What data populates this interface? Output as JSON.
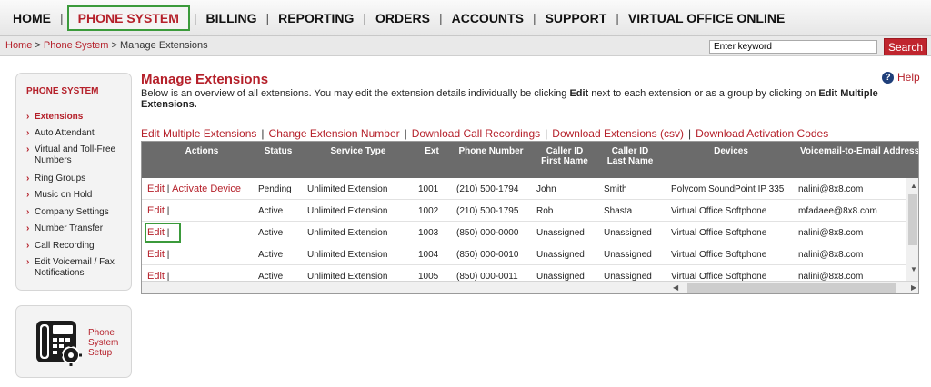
{
  "nav": {
    "items": [
      "HOME",
      "PHONE SYSTEM",
      "BILLING",
      "REPORTING",
      "ORDERS",
      "ACCOUNTS",
      "SUPPORT",
      "VIRTUAL OFFICE ONLINE"
    ],
    "active_index": 1,
    "separator": "|"
  },
  "breadcrumb": {
    "home": "Home",
    "phone_system": "Phone System",
    "current": "Manage Extensions",
    "separator": ">"
  },
  "search": {
    "value": "Enter keyword",
    "button_label": "Search"
  },
  "sidebar": {
    "title": "PHONE SYSTEM",
    "items": [
      {
        "label": "Extensions",
        "active": true
      },
      {
        "label": "Auto Attendant",
        "active": false
      },
      {
        "label": "Virtual and Toll-Free Numbers",
        "active": false
      },
      {
        "label": "Ring Groups",
        "active": false
      },
      {
        "label": "Music on Hold",
        "active": false
      },
      {
        "label": "Company Settings",
        "active": false
      },
      {
        "label": "Number Transfer",
        "active": false
      },
      {
        "label": "Call Recording",
        "active": false
      },
      {
        "label": "Edit Voicemail / Fax Notifications",
        "active": false
      }
    ]
  },
  "setup": {
    "line1": "Phone",
    "line2": "System",
    "line3": "Setup"
  },
  "main": {
    "title": "Manage Extensions",
    "help_label": "Help",
    "description_pre": "Below is an overview of all extensions. You may edit the extension details individually be clicking ",
    "description_edit": "Edit",
    "description_mid": " next to each extension or as a group by clicking on ",
    "description_multi": "Edit Multiple Extensions.",
    "actions": [
      "Edit Multiple Extensions",
      "Change Extension Number",
      "Download Call Recordings",
      "Download Extensions (csv)",
      "Download Activation Codes"
    ]
  },
  "table": {
    "headers": {
      "actions": "Actions",
      "status": "Status",
      "service_type": "Service Type",
      "ext": "Ext",
      "phone_number": "Phone Number",
      "caller_first_1": "Caller ID",
      "caller_first_2": "First Name",
      "caller_last_1": "Caller ID",
      "caller_last_2": "Last Name",
      "devices": "Devices",
      "voicemail": "Voicemail-to-Email Address"
    },
    "edit_label": "Edit",
    "activate_label": "Activate Device",
    "rows": [
      {
        "status": "Pending",
        "service_type": "Unlimited Extension",
        "ext": "1001",
        "phone": "(210) 500-1794",
        "first": "John",
        "last": "Smith",
        "device": "Polycom SoundPoint IP 335",
        "email": "nalini@8x8.com"
      },
      {
        "status": "Active",
        "service_type": "Unlimited Extension",
        "ext": "1002",
        "phone": "(210) 500-1795",
        "first": "Rob",
        "last": "Shasta",
        "device": "Virtual Office Softphone",
        "email": "mfadaee@8x8.com"
      },
      {
        "status": "Active",
        "service_type": "Unlimited Extension",
        "ext": "1003",
        "phone": "(850) 000-0000",
        "first": "Unassigned",
        "last": "Unassigned",
        "device": "Virtual Office Softphone",
        "email": "nalini@8x8.com"
      },
      {
        "status": "Active",
        "service_type": "Unlimited Extension",
        "ext": "1004",
        "phone": "(850) 000-0010",
        "first": "Unassigned",
        "last": "Unassigned",
        "device": "Virtual Office Softphone",
        "email": "nalini@8x8.com"
      },
      {
        "status": "Active",
        "service_type": "Unlimited Extension",
        "ext": "1005",
        "phone": "(850) 000-0011",
        "first": "Unassigned",
        "last": "Unassigned",
        "device": "Virtual Office Softphone",
        "email": "nalini@8x8.com"
      }
    ]
  }
}
